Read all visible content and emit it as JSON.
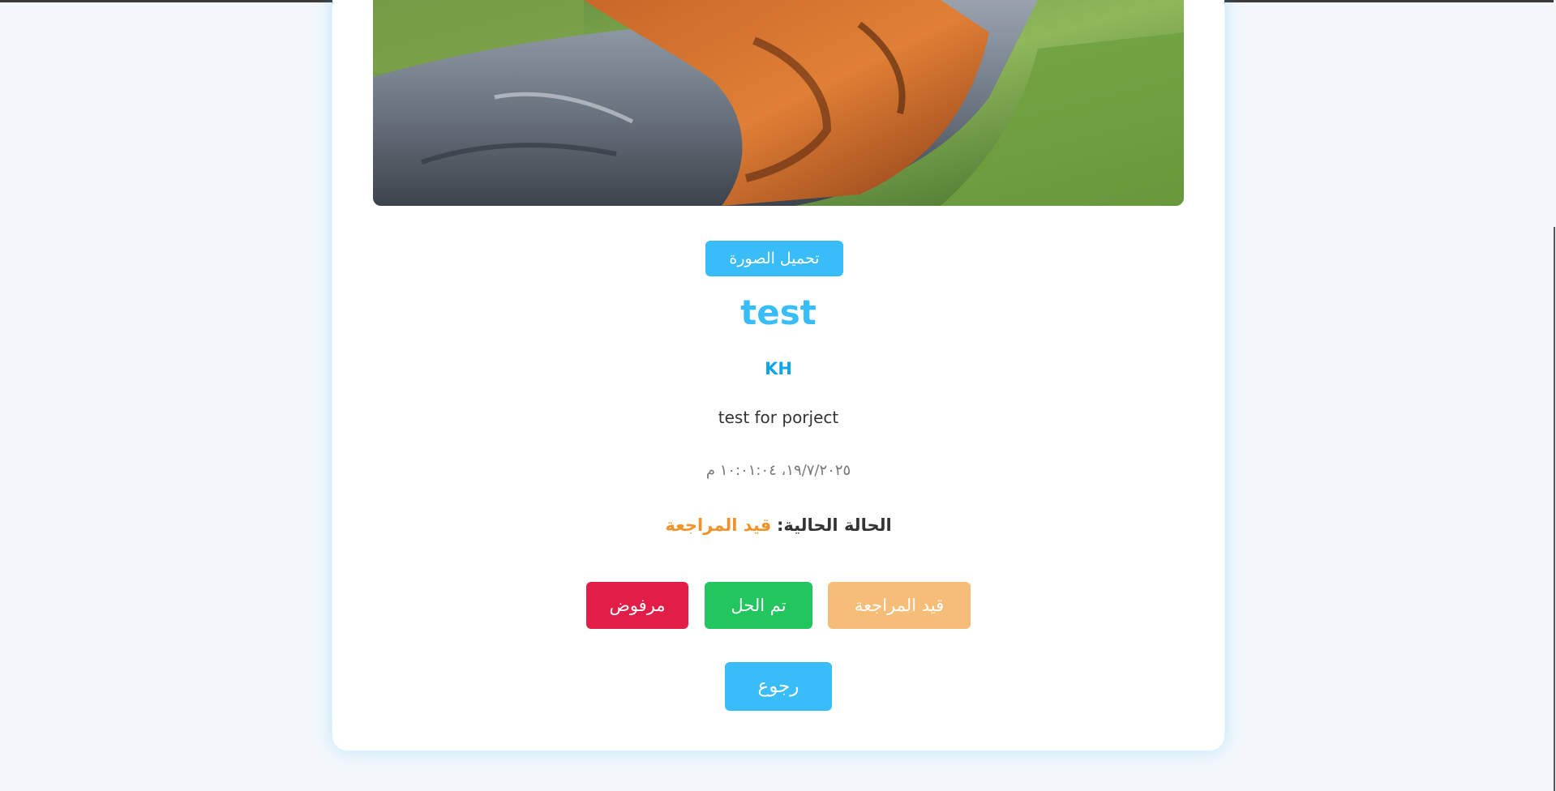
{
  "report": {
    "download_label": "تحميل الصورة",
    "title": "test",
    "author": "KH",
    "description": "test for porject",
    "datetime": "١٩/٧/٢٠٢٥، ١٠:٠١:٠٤ م",
    "status_label": "الحالة الحالية:",
    "status_value": "قيد المراجعة"
  },
  "actions": {
    "pending_label": "قيد المراجعة",
    "solved_label": "تم الحل",
    "rejected_label": "مرفوض",
    "back_label": "رجوع"
  },
  "colors": {
    "accent": "#38bdf8",
    "pending": "#f6bd79",
    "solved": "#22c55e",
    "rejected": "#e11d48",
    "status_text": "#f0932b"
  }
}
